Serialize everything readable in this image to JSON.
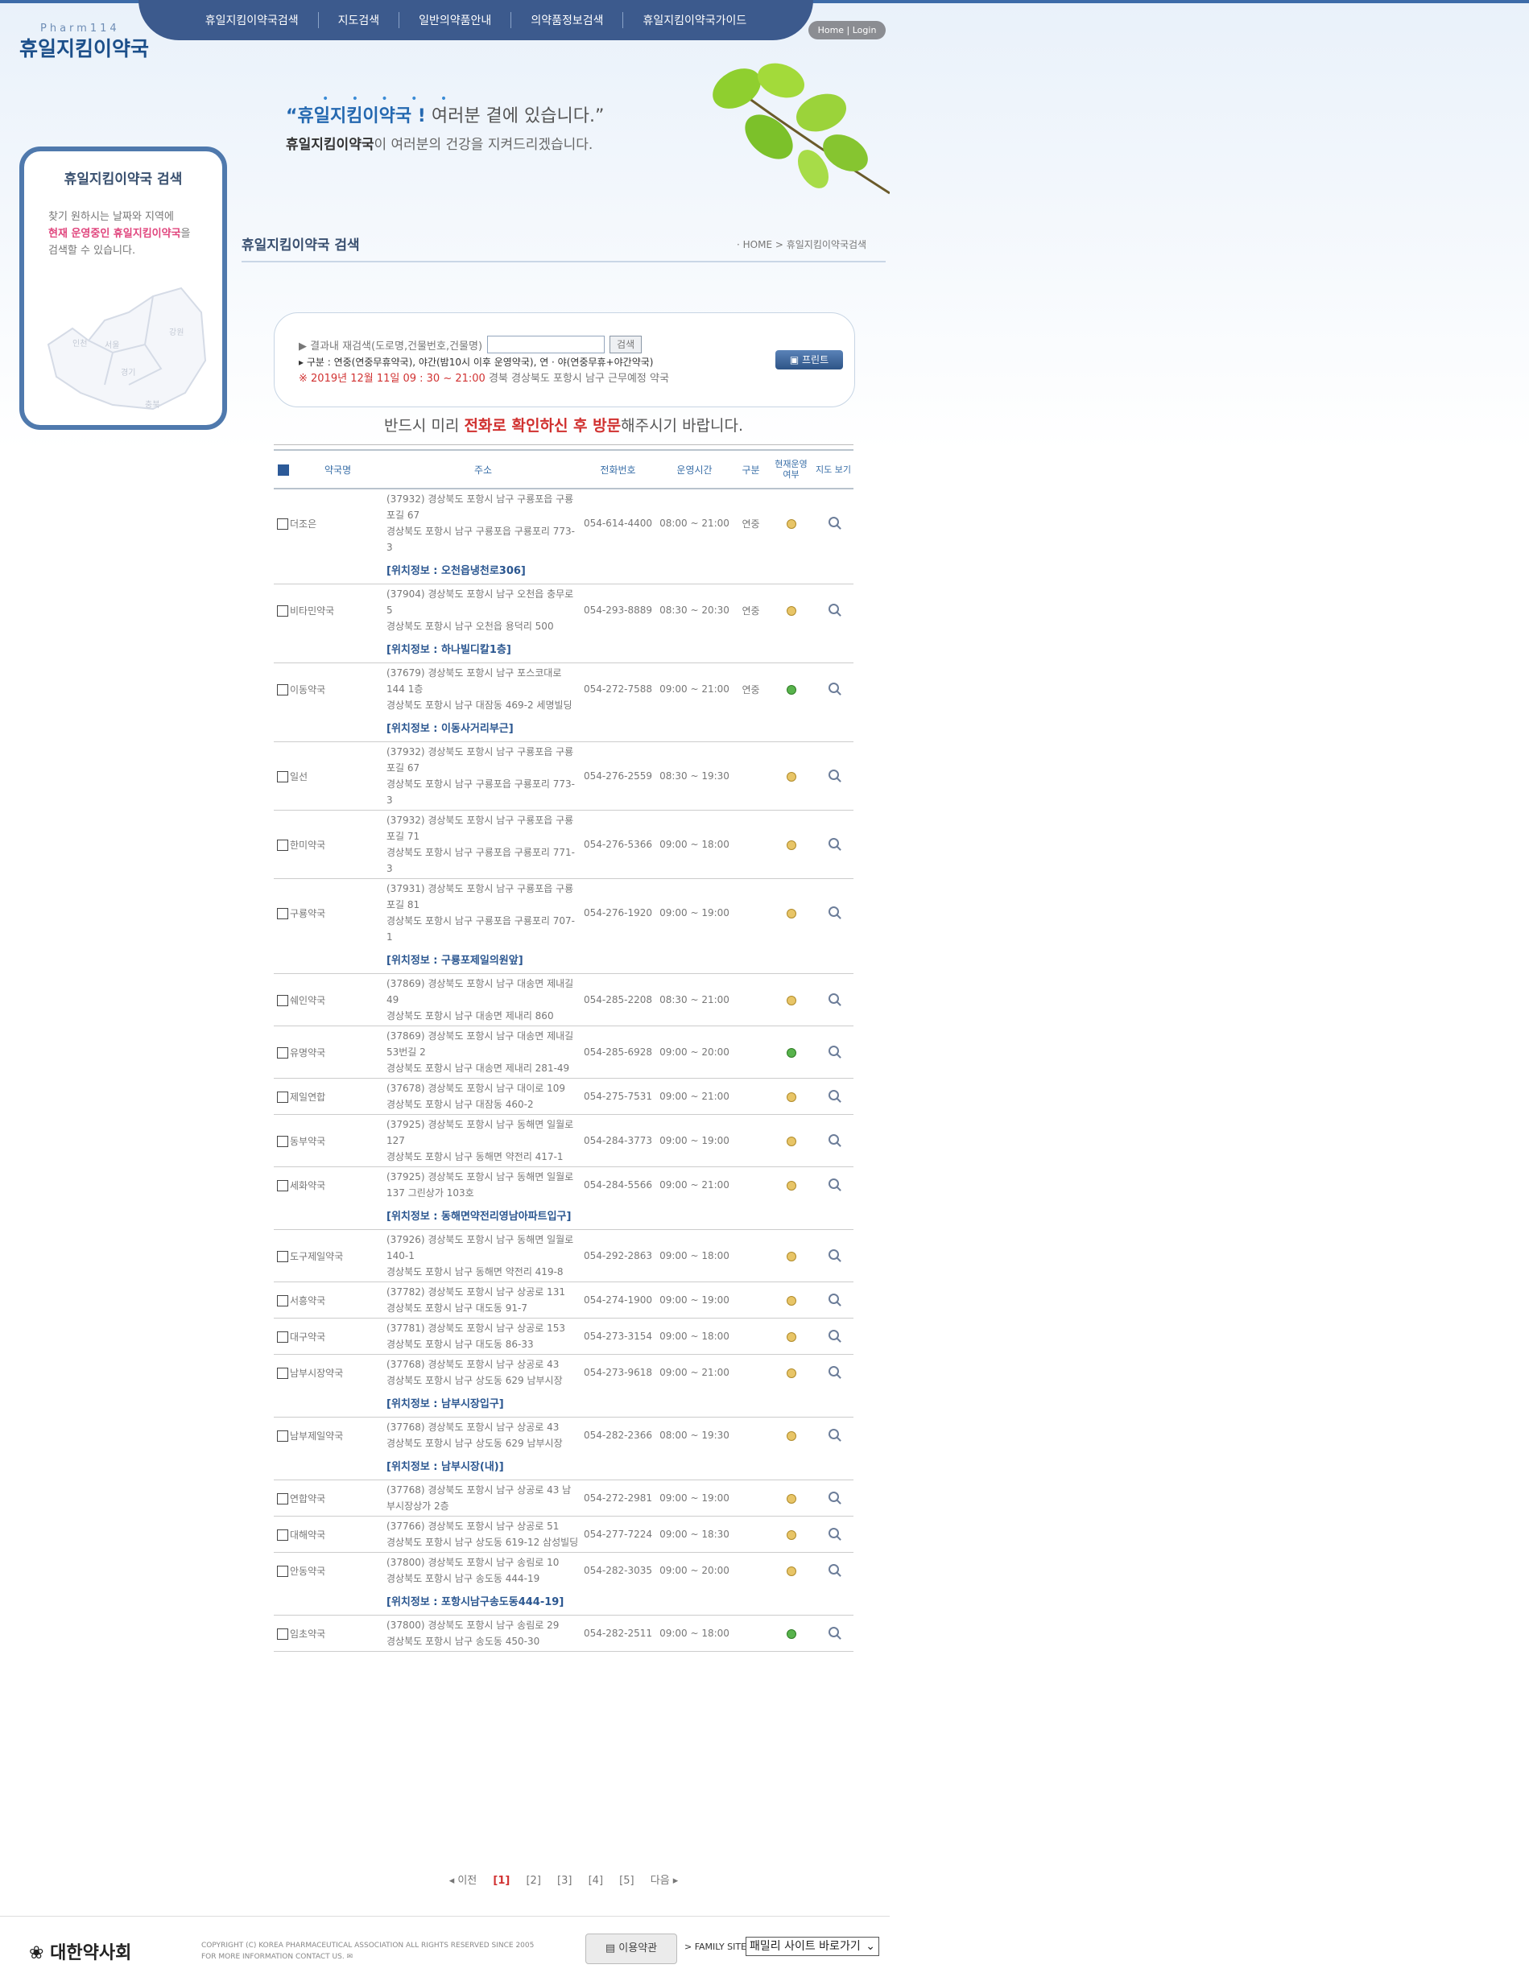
{
  "header": {
    "logo_sub": "Pharm114",
    "logo_main": "휴일지킴이약국",
    "nav": [
      "휴일지킴이약국검색",
      "지도검색",
      "일반의약품안내",
      "의약품정보검색",
      "휴일지킴이약국가이드"
    ],
    "home_login": "Home | Login",
    "stars": "• • • • •",
    "banner_line1_bold": "“휴일지킴이약국 !",
    "banner_line1_rest": "여러분 곁에 있습니다.”",
    "banner_line2_bold": "휴일지킴이약국",
    "banner_line2_rest": "이 여러분의 건강을 지켜드리겠습니다."
  },
  "sidebar": {
    "title": "휴일지킴이약국 검색",
    "text1": "찾기 원하시는 날짜와 지역에",
    "text2_pink": "현재 운영중인 휴일지킴이약국",
    "text2_rest": "을",
    "text3": "검색할 수 있습니다.",
    "map_labels": [
      "인천",
      "서울",
      "경기",
      "강원",
      "충북"
    ]
  },
  "page": {
    "title": "휴일지킴이약국 검색",
    "breadcrumb": "· HOME > 휴일지킴이약국검색"
  },
  "search": {
    "label": "▶  결과내 재검색(도로명,건물번호,건물명)",
    "input_value": "",
    "button": "검색",
    "legend": "▸ 구분 : 연중(연중무휴약국), 야간(밤10시 이후 운영약국), 연 · 야(연중무휴+야간약국)",
    "date_mark": "※ 2019년 12월 11일 09 : 30 ~ 21:00",
    "date_rest": " 경북  경상북도  포항시 남구   근무예정 약국",
    "print": "프린트"
  },
  "notice": {
    "before": "반드시 미리 ",
    "highlight": "전화로 확인하신 후 방문",
    "after": "해주시기 바랍니다."
  },
  "table": {
    "headers": [
      "약국명",
      "주소",
      "전화번호",
      "운영시간",
      "구분",
      "현재운영 여부",
      "지도 보기"
    ],
    "rows": [
      {
        "name": "더조은",
        "addr1": "(37932) 경상북도 포항시 남구 구룡포읍 구룡포길 67",
        "addr2": "경상북도 포항시 남구 구룡포읍 구룡포리 773-3",
        "phone": "054-614-4400",
        "hours": "08:00 ~ 21:00",
        "type": "연중",
        "status": "yellow",
        "loc": "[위치정보 : 오천읍냉천로306]"
      },
      {
        "name": "비타민약국",
        "addr1": "(37904) 경상북도 포항시 남구 오천읍 충무로 5",
        "addr2": "경상북도 포항시 남구 오천읍 용덕리 500",
        "phone": "054-293-8889",
        "hours": "08:30 ~ 20:30",
        "type": "연중",
        "status": "yellow",
        "loc": "[위치정보 : 하나빌디칼1층]"
      },
      {
        "name": "이동약국",
        "addr1": "(37679) 경상북도 포항시 남구 포스코대로 144 1층",
        "addr2": "경상북도 포항시 남구 대잠동 469-2 세명빌딩",
        "phone": "054-272-7588",
        "hours": "09:00 ~ 21:00",
        "type": "연중",
        "status": "green",
        "loc": "[위치정보 : 이동사거리부근]"
      },
      {
        "name": "일선",
        "addr1": "(37932) 경상북도 포항시 남구 구룡포읍 구룡포길 67",
        "addr2": "경상북도 포항시 남구 구룡포읍 구룡포리 773-3",
        "phone": "054-276-2559",
        "hours": "08:30 ~ 19:30",
        "type": "",
        "status": "yellow",
        "loc": ""
      },
      {
        "name": "한미약국",
        "addr1": "(37932) 경상북도 포항시 남구 구룡포읍 구룡포길 71",
        "addr2": "경상북도 포항시 남구 구룡포읍 구룡포리 771-3",
        "phone": "054-276-5366",
        "hours": "09:00 ~ 18:00",
        "type": "",
        "status": "yellow",
        "loc": ""
      },
      {
        "name": "구룡약국",
        "addr1": "(37931) 경상북도 포항시 남구 구룡포읍 구룡포길 81",
        "addr2": "경상북도 포항시 남구 구룡포읍 구룡포리 707-1",
        "phone": "054-276-1920",
        "hours": "09:00 ~ 19:00",
        "type": "",
        "status": "yellow",
        "loc": "[위치정보 : 구룡포제일의원앞]"
      },
      {
        "name": "쉐인약국",
        "addr1": "(37869) 경상북도 포항시 남구 대송면 제내길 49",
        "addr2": "경상북도 포항시 남구 대송면 제내리 860",
        "phone": "054-285-2208",
        "hours": "08:30 ~ 21:00",
        "type": "",
        "status": "yellow",
        "loc": ""
      },
      {
        "name": "유명약국",
        "addr1": "(37869) 경상북도 포항시 남구 대송면 제내길53번길 2",
        "addr2": "경상북도 포항시 남구 대송면 제내리 281-49",
        "phone": "054-285-6928",
        "hours": "09:00 ~ 20:00",
        "type": "",
        "status": "green",
        "loc": ""
      },
      {
        "name": "제일연합",
        "addr1": "(37678) 경상북도 포항시 남구 대이로 109",
        "addr2": "경상북도 포항시 남구 대잠동 460-2",
        "phone": "054-275-7531",
        "hours": "09:00 ~ 21:00",
        "type": "",
        "status": "yellow",
        "loc": ""
      },
      {
        "name": "동부약국",
        "addr1": "(37925) 경상북도 포항시 남구 동해면 일월로 127",
        "addr2": "경상북도 포항시 남구 동해면 약전리 417-1",
        "phone": "054-284-3773",
        "hours": "09:00 ~ 19:00",
        "type": "",
        "status": "yellow",
        "loc": ""
      },
      {
        "name": "세화약국",
        "addr1": "(37925) 경상북도 포항시 남구 동해면 일월로 137 그린상가 103호",
        "addr2": "",
        "phone": "054-284-5566",
        "hours": "09:00 ~ 21:00",
        "type": "",
        "status": "yellow",
        "loc": "[위치정보 : 동해면약전리영남아파트입구]"
      },
      {
        "name": "도구제일약국",
        "addr1": "(37926) 경상북도 포항시 남구 동해면 일월로 140-1",
        "addr2": "경상북도 포항시 남구 동해면 약전리 419-8",
        "phone": "054-292-2863",
        "hours": "09:00 ~ 18:00",
        "type": "",
        "status": "yellow",
        "loc": ""
      },
      {
        "name": "서흥약국",
        "addr1": "(37782) 경상북도 포항시 남구 상공로 131",
        "addr2": "경상북도 포항시 남구 대도동 91-7",
        "phone": "054-274-1900",
        "hours": "09:00 ~ 19:00",
        "type": "",
        "status": "yellow",
        "loc": ""
      },
      {
        "name": "대구약국",
        "addr1": "(37781) 경상북도 포항시 남구 상공로 153",
        "addr2": "경상북도 포항시 남구 대도동 86-33",
        "phone": "054-273-3154",
        "hours": "09:00 ~ 18:00",
        "type": "",
        "status": "yellow",
        "loc": ""
      },
      {
        "name": "남부시장약국",
        "addr1": "(37768) 경상북도 포항시 남구 상공로 43",
        "addr2": "경상북도 포항시 남구 상도동 629 남부시장",
        "phone": "054-273-9618",
        "hours": "09:00 ~ 21:00",
        "type": "",
        "status": "yellow",
        "loc": "[위치정보 : 남부시장입구]"
      },
      {
        "name": "남부제일약국",
        "addr1": "(37768) 경상북도 포항시 남구 상공로 43",
        "addr2": "경상북도 포항시 남구 상도동 629 남부시장",
        "phone": "054-282-2366",
        "hours": "08:00 ~ 19:30",
        "type": "",
        "status": "yellow",
        "loc": "[위치정보 : 남부시장(내)]"
      },
      {
        "name": "연합약국",
        "addr1": "(37768) 경상북도 포항시 남구 상공로 43 남부시장상가 2층",
        "addr2": "",
        "phone": "054-272-2981",
        "hours": "09:00 ~ 19:00",
        "type": "",
        "status": "yellow",
        "loc": ""
      },
      {
        "name": "대해약국",
        "addr1": "(37766) 경상북도 포항시 남구 상공로 51",
        "addr2": "경상북도 포항시 남구 상도동 619-12 삼성빌딩",
        "phone": "054-277-7224",
        "hours": "09:00 ~ 18:30",
        "type": "",
        "status": "yellow",
        "loc": ""
      },
      {
        "name": "안동약국",
        "addr1": "(37800) 경상북도 포항시 남구 송림로 10",
        "addr2": "경상북도 포항시 남구 송도동 444-19",
        "phone": "054-282-3035",
        "hours": "09:00 ~ 20:00",
        "type": "",
        "status": "yellow",
        "loc": "[위치정보 : 포항시남구송도동444-19]"
      },
      {
        "name": "임초약국",
        "addr1": "(37800) 경상북도 포항시 남구 송림로 29",
        "addr2": "경상북도 포항시 남구 송도동 450-30",
        "phone": "054-282-2511",
        "hours": "09:00 ~ 18:00",
        "type": "",
        "status": "green",
        "loc": ""
      }
    ]
  },
  "pager": {
    "prev": "◂ 이전",
    "pages": [
      "[1]",
      "[2]",
      "[3]",
      "[4]",
      "[5]"
    ],
    "current": "[1]",
    "next": "다음 ▸"
  },
  "footer": {
    "logo": "대한약사회",
    "copyright1": "COPYRIGHT (C) KOREA PHARMACEUTICAL ASSOCIATION ALL RIGHTS RESERVED SINCE 2005",
    "copyright2": "FOR MORE INFORMATION CONTACT US.",
    "terms": "이용약관",
    "family_label": "> FAMILY SITE",
    "family_select": "패밀리 사이트 바로가기"
  }
}
